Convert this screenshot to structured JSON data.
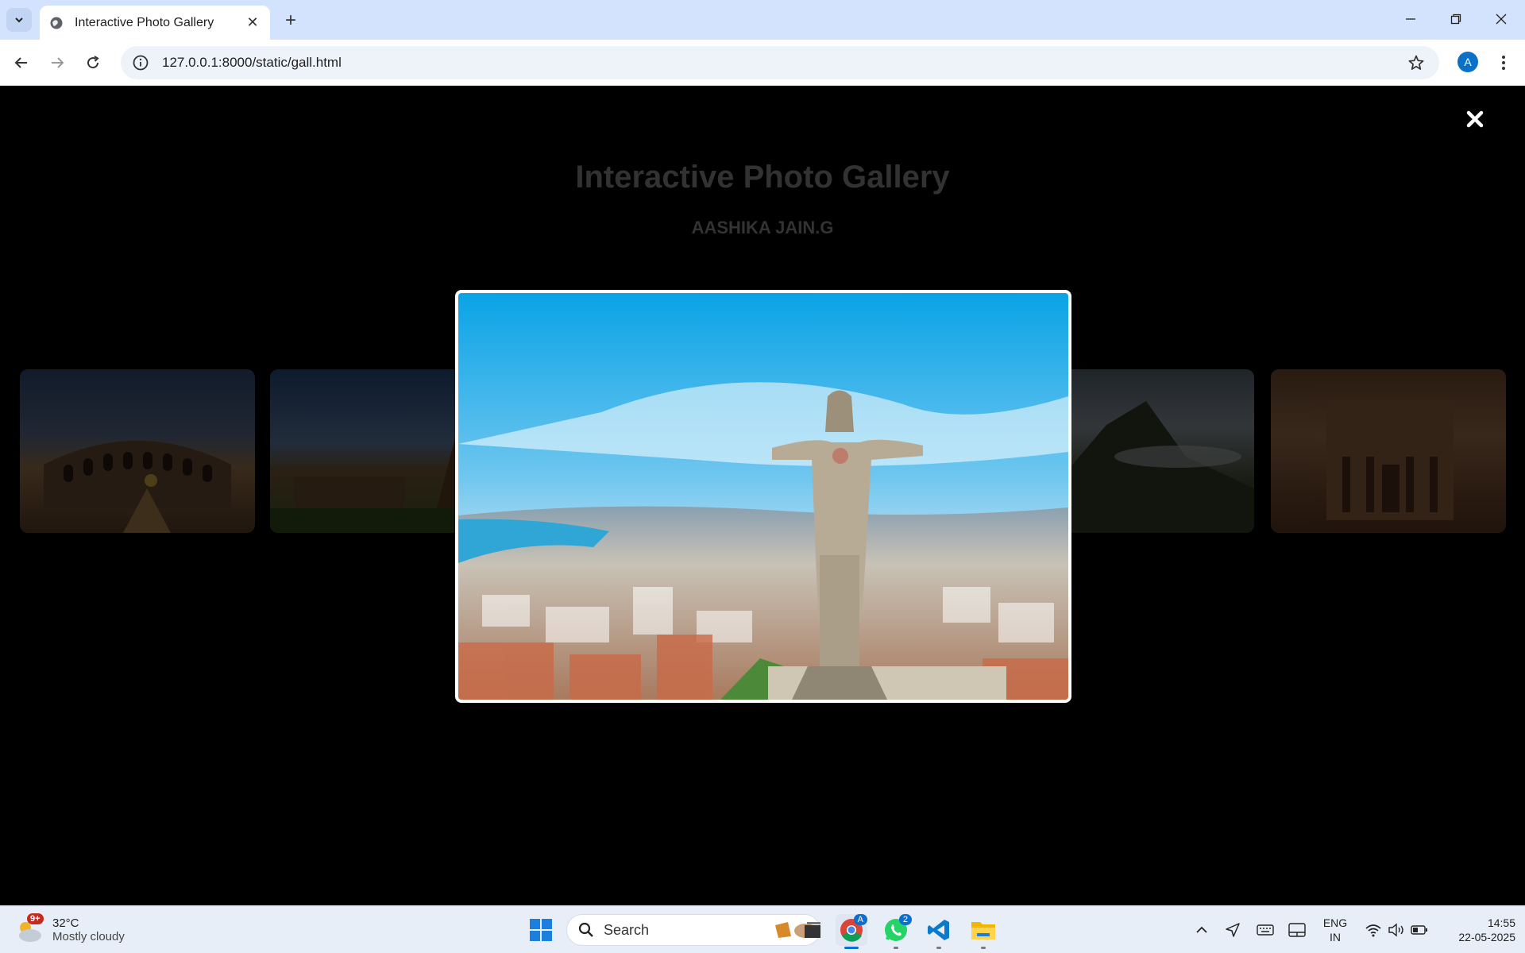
{
  "browser": {
    "tab_title": "Interactive Photo Gallery",
    "url": "127.0.0.1:8000/static/gall.html",
    "profile_initial": "A"
  },
  "page": {
    "title": "Interactive Photo Gallery",
    "author": "AASHIKA JAIN.G"
  },
  "gallery": {
    "thumbnails": [
      "colosseum",
      "temple",
      "machu-picchu",
      "petra"
    ],
    "modal_image": "christ-the-king-statue"
  },
  "taskbar": {
    "weather_badge": "9+",
    "temperature": "32°C",
    "condition": "Mostly cloudy",
    "search_label": "Search",
    "chrome_badge": "A",
    "whatsapp_badge": "2",
    "language": "ENG",
    "region": "IN",
    "time": "14:55",
    "date": "22-05-2025"
  },
  "colors": {
    "tabstrip": "#d3e3fd",
    "page_bg": "#000000",
    "accent": "#0b6fd1"
  }
}
